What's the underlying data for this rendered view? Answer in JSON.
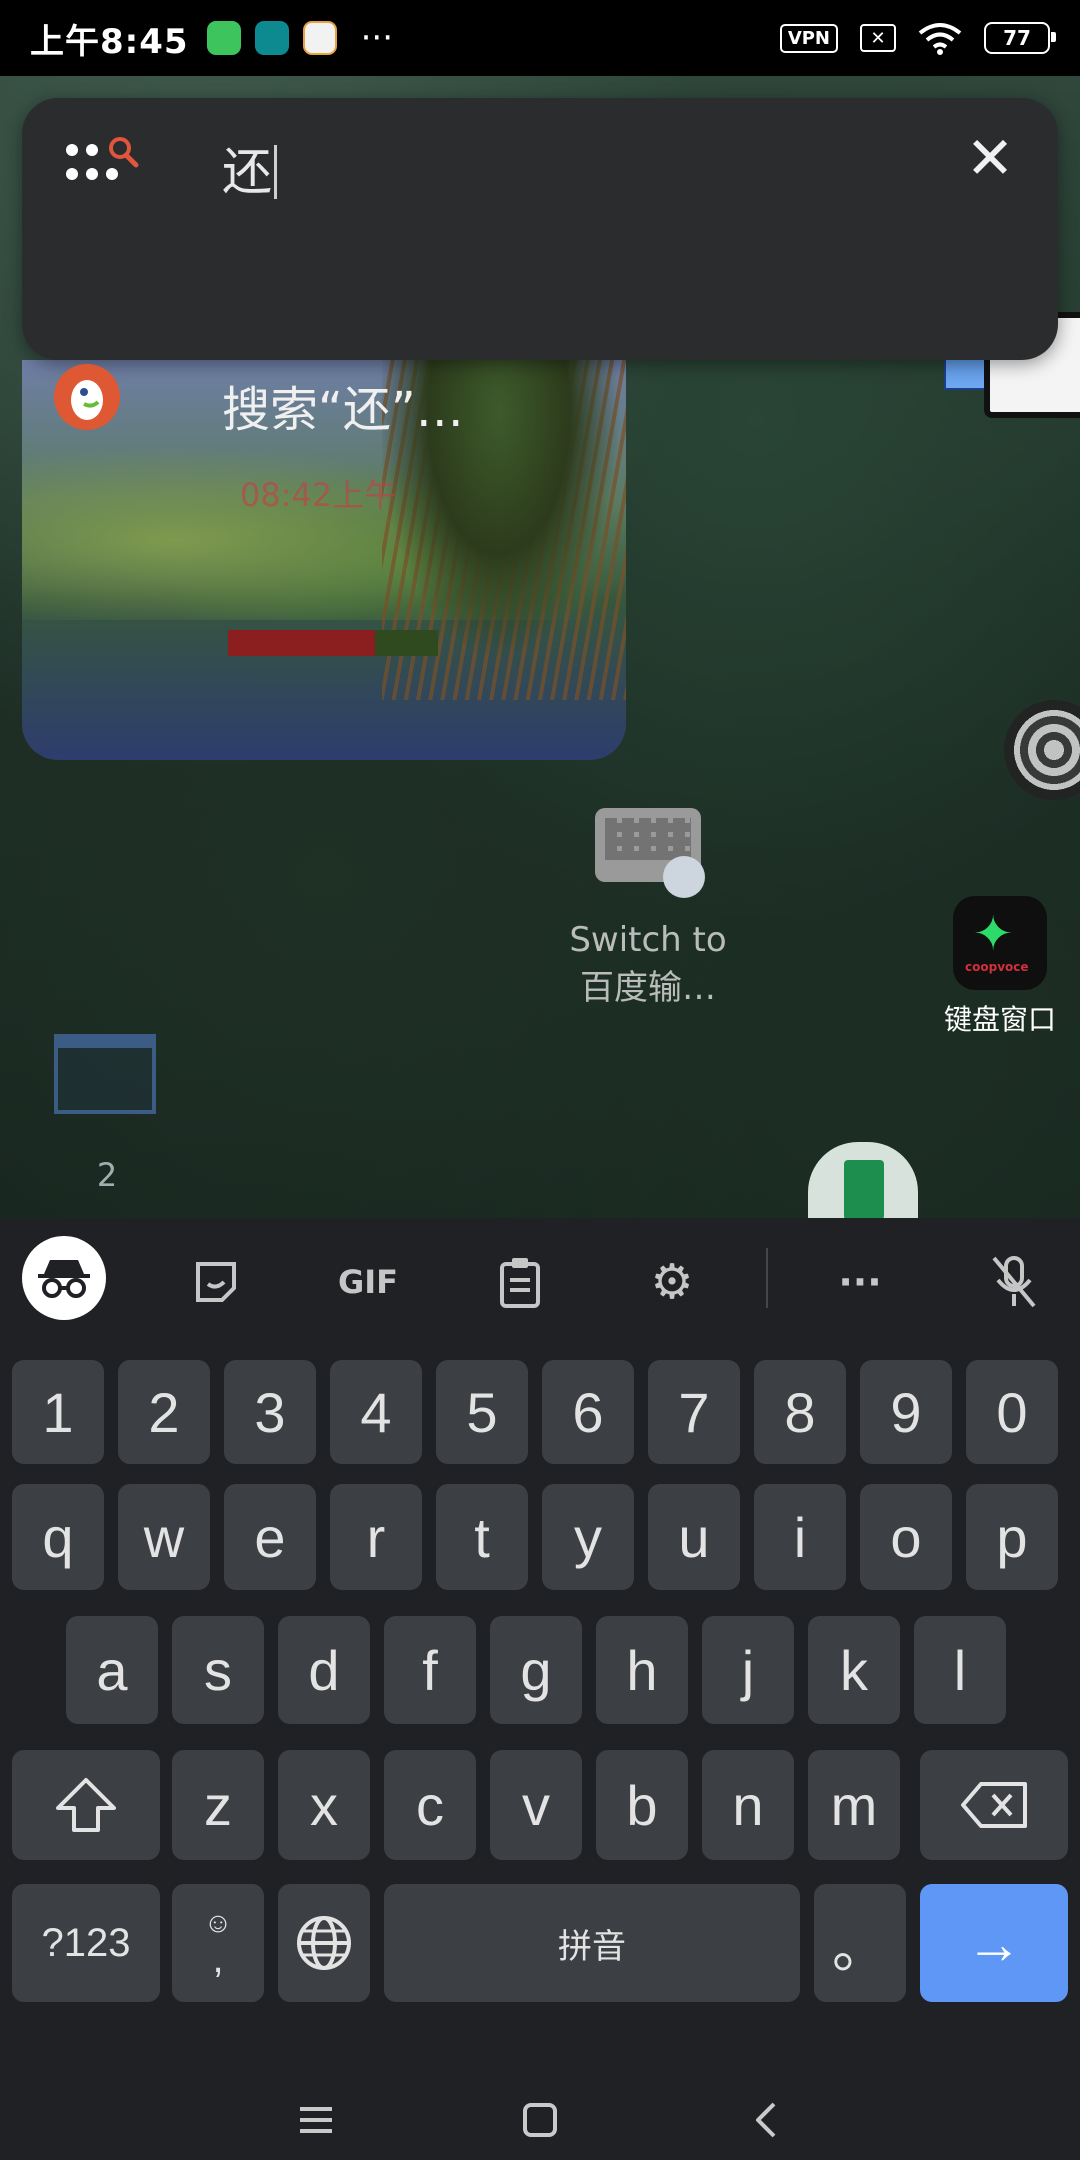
{
  "status_bar": {
    "time": "上午8:45",
    "vpn_label": "VPN",
    "battery": "77",
    "more": "···"
  },
  "search": {
    "query": "还",
    "result_text": "搜索“还”…"
  },
  "widget": {
    "time_text": "08:42上午",
    "progress": 0.7
  },
  "desktop": {
    "switch_label_line1": "Switch to",
    "switch_label_line2": "百度输…",
    "app_label": "键盘窗口",
    "app_icon_sub": "coopvoce",
    "page_number": "2"
  },
  "keyboard": {
    "toolbar": {
      "gif_label": "GIF",
      "more_label": "···"
    },
    "rows": {
      "numbers": [
        "1",
        "2",
        "3",
        "4",
        "5",
        "6",
        "7",
        "8",
        "9",
        "0"
      ],
      "row1": [
        "q",
        "w",
        "e",
        "r",
        "t",
        "y",
        "u",
        "i",
        "o",
        "p"
      ],
      "row2": [
        "a",
        "s",
        "d",
        "f",
        "g",
        "h",
        "j",
        "k",
        "l"
      ],
      "row3": [
        "z",
        "x",
        "c",
        "v",
        "b",
        "n",
        "m"
      ]
    },
    "symbols_label": "?123",
    "comma_label": ",",
    "space_label": "拼音",
    "period_label": "。",
    "enter_label": "→"
  },
  "colors": {
    "keyboard_bg": "#202124",
    "key_bg": "#3c3f43",
    "enter_bg": "#5e97f6",
    "search_panel_bg": "#2b2c2e"
  }
}
